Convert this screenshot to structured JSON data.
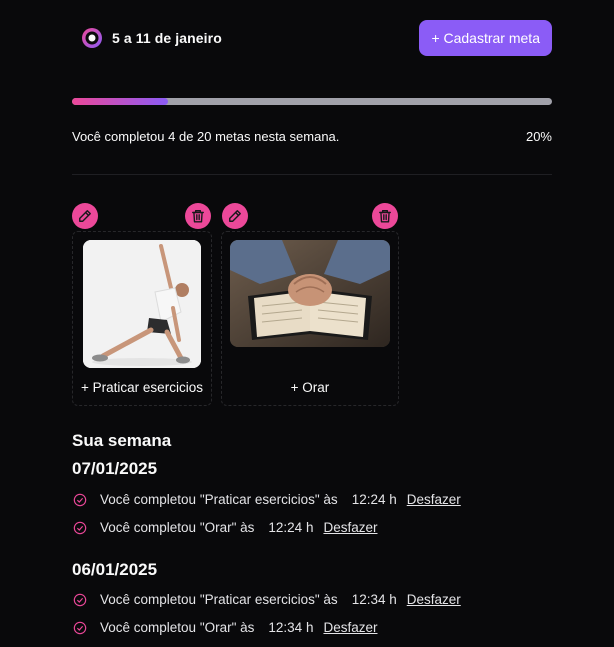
{
  "header": {
    "week_label": "5 a 11 de janeiro",
    "add_goal_label": "+ Cadastrar meta"
  },
  "progress": {
    "completed": 4,
    "total": 20,
    "fraction": 0.2,
    "summary_text": "Você completou 4 de 20 metas nesta semana.",
    "percent_label": "20%"
  },
  "goals": [
    {
      "label": "+ Praticar esercicios",
      "image": "person-stretching-photo"
    },
    {
      "label": "+ Orar",
      "image": "praying-hands-bible-photo"
    }
  ],
  "history": {
    "title": "Sua semana",
    "undo_label": "Desfazer",
    "days": [
      {
        "date": "07/01/2025",
        "entries": [
          {
            "text": "Você completou \"Praticar esercicios\" às",
            "time": "12:24 h"
          },
          {
            "text": "Você completou \"Orar\" às",
            "time": "12:24 h"
          }
        ]
      },
      {
        "date": "06/01/2025",
        "entries": [
          {
            "text": "Você completou \"Praticar esercicios\" às",
            "time": "12:34 h"
          },
          {
            "text": "Você completou \"Orar\" às",
            "time": "12:34 h"
          }
        ]
      }
    ]
  },
  "colors": {
    "background": "#09090b",
    "primary": "#8b5cf6",
    "accent": "#ec4899",
    "track": "#a1a1aa"
  },
  "icons": [
    "app-logo-icon",
    "pencil-icon",
    "trash-icon",
    "check-circle-icon"
  ]
}
